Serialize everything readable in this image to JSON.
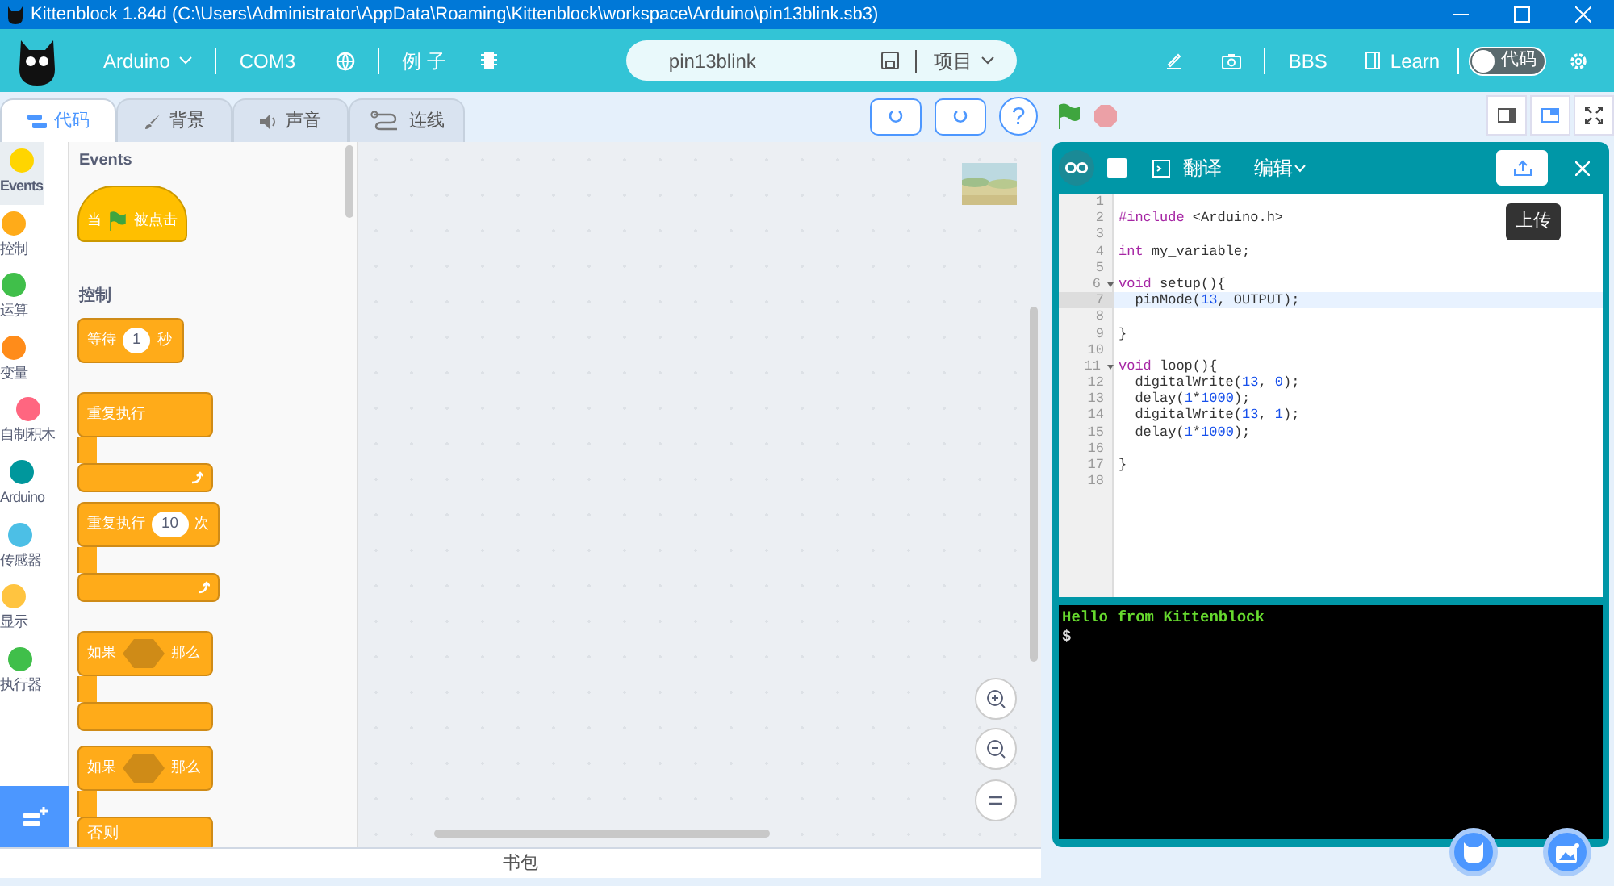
{
  "window": {
    "title": "Kittenblock 1.84d (C:\\Users\\Administrator\\AppData\\Roaming\\Kittenblock\\workspace\\Arduino\\pin13blink.sb3)"
  },
  "menu": {
    "board": "Arduino",
    "port": "COM3",
    "examples": "例 子",
    "project_name": "pin13blink",
    "project_menu": "项目",
    "bbs": "BBS",
    "learn": "Learn",
    "code_toggle": {
      "label": "代码",
      "on": false
    }
  },
  "tabs": [
    {
      "label": "代码",
      "selected": true
    },
    {
      "label": "背景",
      "selected": false
    },
    {
      "label": "声音",
      "selected": false
    },
    {
      "label": "连线",
      "selected": false
    }
  ],
  "help": "?",
  "categories": [
    {
      "label": "Events",
      "color": "#ffd500",
      "selected": true
    },
    {
      "label": "控制",
      "color": "#ffab19",
      "selected": false
    },
    {
      "label": "运算",
      "color": "#40bf4a",
      "selected": false
    },
    {
      "label": "变量",
      "color": "#ff8c1a",
      "selected": false
    },
    {
      "label": "自制积木",
      "color": "#ff6680",
      "selected": false
    },
    {
      "label": "Arduino",
      "color": "#00979c",
      "selected": false
    },
    {
      "label": "传感器",
      "color": "#4cbfe6",
      "selected": false
    },
    {
      "label": "显示",
      "color": "#ffc440",
      "selected": false
    },
    {
      "label": "执行器",
      "color": "#40bf4a",
      "selected": false
    }
  ],
  "palette": [
    {
      "kind": "heading",
      "text": "Events"
    },
    {
      "kind": "hat",
      "parts": [
        {
          "kind": "text",
          "text": "当"
        },
        {
          "kind": "flag"
        },
        {
          "kind": "text",
          "text": "被点击"
        }
      ]
    },
    {
      "kind": "heading",
      "text": "控制"
    },
    {
      "kind": "command",
      "parts": [
        {
          "kind": "text",
          "text": "等待"
        },
        {
          "kind": "input",
          "text": "1"
        },
        {
          "kind": "text",
          "text": "秒"
        }
      ]
    },
    {
      "kind": "loop",
      "parts": [
        {
          "kind": "text",
          "text": "重复执行"
        }
      ]
    },
    {
      "kind": "loop",
      "parts": [
        {
          "kind": "text",
          "text": "重复执行"
        },
        {
          "kind": "input",
          "text": "10"
        },
        {
          "kind": "text",
          "text": "次"
        }
      ]
    },
    {
      "kind": "if",
      "parts": [
        {
          "kind": "text",
          "text": "如果"
        },
        {
          "kind": "condition"
        },
        {
          "kind": "text",
          "text": "那么"
        }
      ]
    },
    {
      "kind": "if_else",
      "parts": [
        {
          "kind": "text",
          "text": "如果"
        },
        {
          "kind": "condition"
        },
        {
          "kind": "text",
          "text": "那么"
        }
      ],
      "else_label": "否则"
    }
  ],
  "editor": {
    "translate": "翻译",
    "edit": "编辑",
    "upload_tooltip": "上传",
    "lines": [
      {
        "number": "1",
        "active": false,
        "foldable": false
      },
      {
        "number": "2",
        "active": false,
        "foldable": false,
        "code": [
          {
            "text": "#include",
            "kind": "meta"
          },
          {
            "text": " <Arduino.h>",
            "kind": "plain"
          }
        ]
      },
      {
        "number": "3",
        "active": false,
        "foldable": false
      },
      {
        "number": "4",
        "active": false,
        "foldable": false,
        "code": [
          {
            "text": "int",
            "kind": "keyword"
          },
          {
            "text": " my_variable;",
            "kind": "plain"
          }
        ]
      },
      {
        "number": "5",
        "active": false,
        "foldable": false
      },
      {
        "number": "6",
        "active": false,
        "foldable": true,
        "code": [
          {
            "text": "void",
            "kind": "keyword"
          },
          {
            "text": " setup(){",
            "kind": "plain"
          }
        ]
      },
      {
        "number": "7",
        "active": true,
        "foldable": false,
        "code": [
          {
            "text": "  pinMode(",
            "kind": "plain"
          },
          {
            "text": "13",
            "kind": "number"
          },
          {
            "text": ", OUTPUT);",
            "kind": "plain"
          }
        ]
      },
      {
        "number": "8",
        "active": false,
        "foldable": false
      },
      {
        "number": "9",
        "active": false,
        "foldable": false,
        "code": [
          {
            "text": "}",
            "kind": "plain"
          }
        ]
      },
      {
        "number": "10",
        "active": false,
        "foldable": false
      },
      {
        "number": "11",
        "active": false,
        "foldable": true,
        "code": [
          {
            "text": "void",
            "kind": "keyword"
          },
          {
            "text": " loop(){",
            "kind": "plain"
          }
        ]
      },
      {
        "number": "12",
        "active": false,
        "foldable": false,
        "code": [
          {
            "text": "  digitalWrite(",
            "kind": "plain"
          },
          {
            "text": "13",
            "kind": "number"
          },
          {
            "text": ", ",
            "kind": "plain"
          },
          {
            "text": "0",
            "kind": "number"
          },
          {
            "text": ");",
            "kind": "plain"
          }
        ]
      },
      {
        "number": "13",
        "active": false,
        "foldable": false,
        "code": [
          {
            "text": "  delay(",
            "kind": "plain"
          },
          {
            "text": "1",
            "kind": "number"
          },
          {
            "text": "*",
            "kind": "plain"
          },
          {
            "text": "1000",
            "kind": "number"
          },
          {
            "text": ");",
            "kind": "plain"
          }
        ]
      },
      {
        "number": "14",
        "active": false,
        "foldable": false,
        "code": [
          {
            "text": "  digitalWrite(",
            "kind": "plain"
          },
          {
            "text": "13",
            "kind": "number"
          },
          {
            "text": ", ",
            "kind": "plain"
          },
          {
            "text": "1",
            "kind": "number"
          },
          {
            "text": ");",
            "kind": "plain"
          }
        ]
      },
      {
        "number": "15",
        "active": false,
        "foldable": false,
        "code": [
          {
            "text": "  delay(",
            "kind": "plain"
          },
          {
            "text": "1",
            "kind": "number"
          },
          {
            "text": "*",
            "kind": "plain"
          },
          {
            "text": "1000",
            "kind": "number"
          },
          {
            "text": ");",
            "kind": "plain"
          }
        ]
      },
      {
        "number": "16",
        "active": false,
        "foldable": false
      },
      {
        "number": "17",
        "active": false,
        "foldable": false,
        "code": [
          {
            "text": "}",
            "kind": "plain"
          }
        ]
      },
      {
        "number": "18",
        "active": false,
        "foldable": false
      }
    ]
  },
  "terminal": [
    {
      "kind": "output",
      "text": "Hello from Kittenblock"
    },
    {
      "kind": "prompt",
      "text": "$"
    }
  ],
  "backpack": "书包"
}
